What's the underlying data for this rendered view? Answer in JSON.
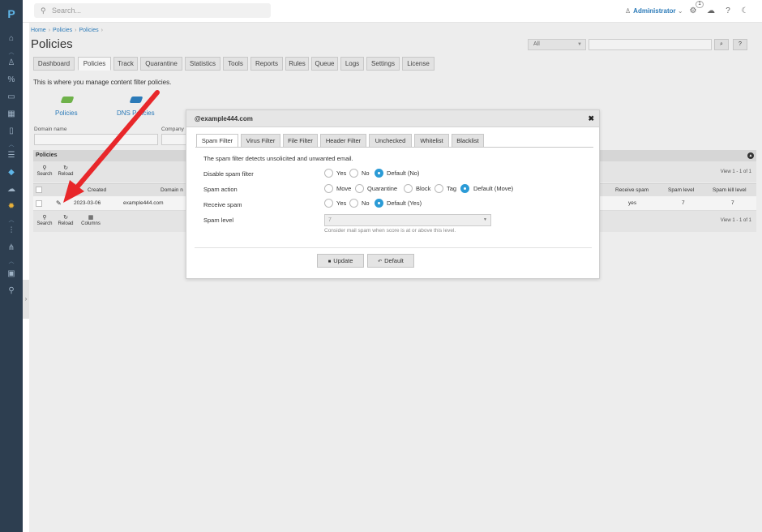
{
  "app": {
    "logo": "P"
  },
  "sidebar": {
    "icons": [
      "home-icon",
      "user-icon",
      "percent-icon",
      "monitor-icon",
      "grid-icon",
      "book-icon",
      "list-icon",
      "shield-icon",
      "cloud-icon",
      "settings-icon",
      "sliders-icon",
      "node-icon",
      "box-icon",
      "key-icon"
    ]
  },
  "topbar": {
    "search_placeholder": "Search...",
    "user": "Administrator",
    "notif_count": "1"
  },
  "breadcrumb": [
    "Home",
    "Policies",
    "Policies"
  ],
  "page": {
    "title": "Policies",
    "intro": "This is where you manage content filter policies.",
    "filter_select": "All",
    "search_btn": "⌕",
    "help_btn": "?"
  },
  "tabs": [
    "Dashboard",
    "Policies",
    "Track",
    "Quarantine",
    "Statistics",
    "Tools",
    "Reports",
    "Rules",
    "Queue",
    "Logs",
    "Settings",
    "License"
  ],
  "quicklinks": [
    {
      "label": "Policies",
      "color": "#6fb24a"
    },
    {
      "label": "DNS Policies",
      "color": "#2b7ab8"
    }
  ],
  "filters": {
    "domain_label": "Domain name",
    "company_label": "Company"
  },
  "panel": {
    "title": "Policies",
    "search": "Search",
    "reload": "Reload",
    "columns": "Columns",
    "pager": "View 1 - 1 of 1"
  },
  "table": {
    "headers": [
      "Created",
      "Domain n",
      "Receive spam",
      "Spam level",
      "Spam kill level"
    ],
    "row": {
      "created": "2023-03-06",
      "domain": "example444.com",
      "receive_spam": "yes",
      "spam_level": "7",
      "spam_kill_level": "7"
    }
  },
  "modal": {
    "title": "@example444.com",
    "close": "✖",
    "tabs": [
      "Spam Filter",
      "Virus Filter",
      "File Filter",
      "Header Filter",
      "Unchecked",
      "Whitelist",
      "Blacklist"
    ],
    "description": "The spam filter detects unsolicited and unwanted email.",
    "fields": {
      "disable": {
        "label": "Disable spam filter",
        "options": [
          "Yes",
          "No",
          "Default (No)"
        ],
        "selected": 2
      },
      "action": {
        "label": "Spam action",
        "options": [
          "Move",
          "Quarantine",
          "Block",
          "Tag",
          "Default (Move)"
        ],
        "selected": 4
      },
      "receive": {
        "label": "Receive spam",
        "options": [
          "Yes",
          "No",
          "Default (Yes)"
        ],
        "selected": 2
      },
      "level": {
        "label": "Spam level",
        "value": "7",
        "hint": "Consider mail spam when score is at or above this level."
      }
    },
    "buttons": {
      "update": "Update",
      "default": "Default"
    }
  },
  "colors": {
    "accent": "#2b9bd6",
    "sidebar": "#2d3e50",
    "link": "#2b7ab8",
    "annotation_arrow": "#e8272a"
  }
}
